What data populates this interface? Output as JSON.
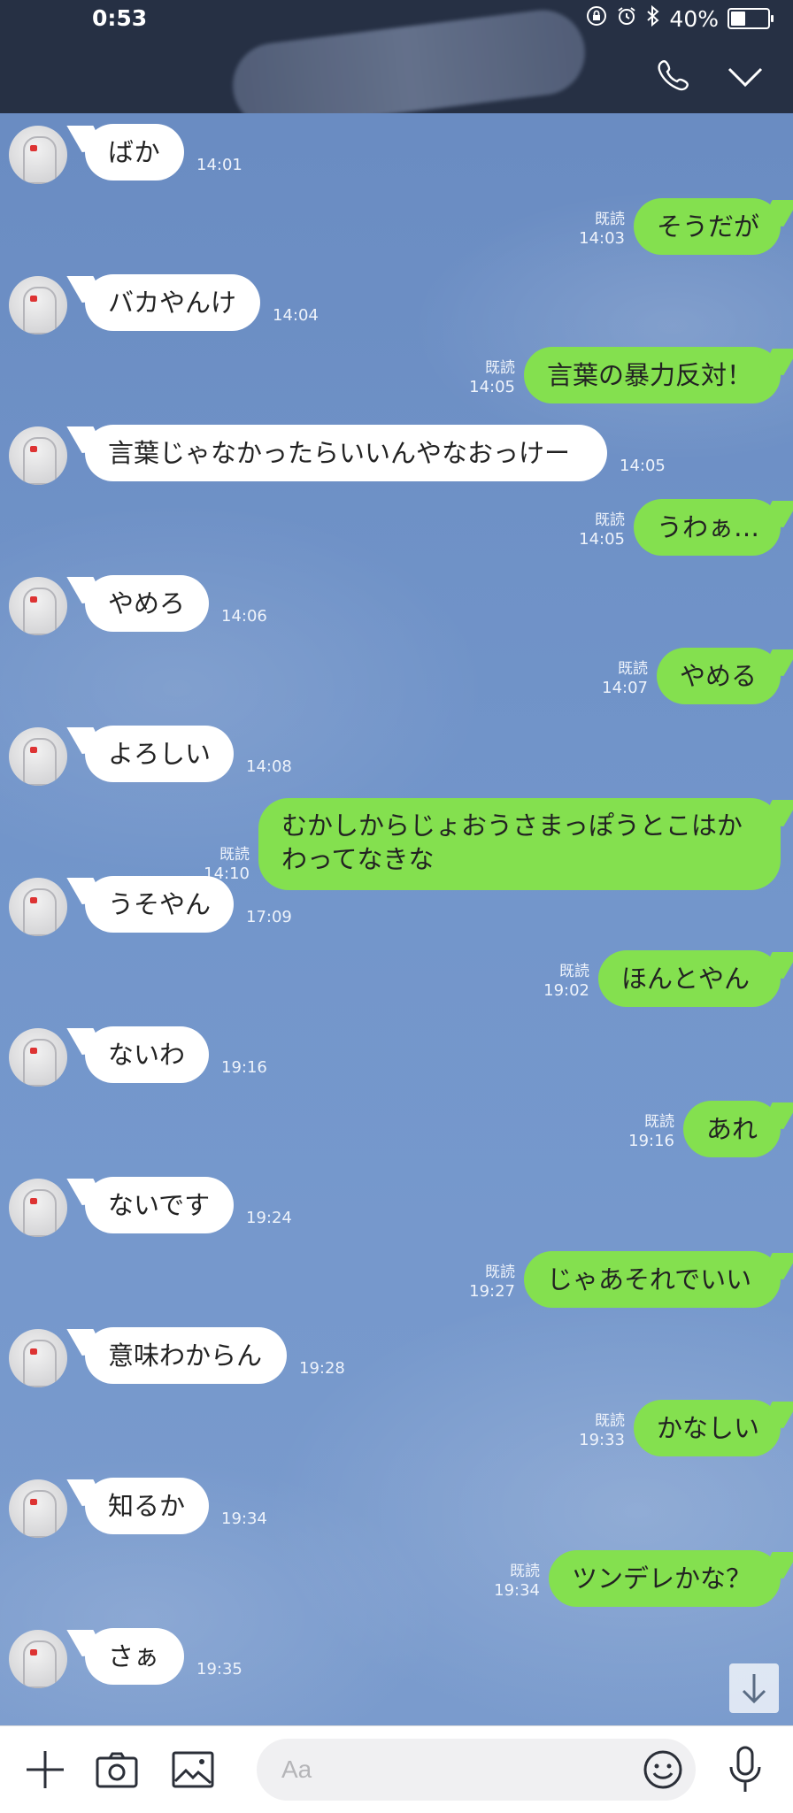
{
  "status_bar": {
    "time": "0:53",
    "battery": "40%",
    "battery_level": 0.4
  },
  "header": {
    "call_icon": "phone-icon",
    "collapse_icon": "chevron-down-icon"
  },
  "read_label": "既読",
  "messages": [
    {
      "side": "in",
      "text": "ばか",
      "time": "14:01"
    },
    {
      "side": "out",
      "text": "そうだが",
      "time": "14:03",
      "read": true
    },
    {
      "side": "in",
      "text": "バカやんけ",
      "time": "14:04"
    },
    {
      "side": "out",
      "text": "言葉の暴力反対！",
      "time": "14:05",
      "read": true
    },
    {
      "side": "in",
      "text": "言葉じゃなかったらいいんやなおっけー",
      "time": "14:05"
    },
    {
      "side": "out",
      "text": "うわぁ…",
      "time": "14:05",
      "read": true
    },
    {
      "side": "in",
      "text": "やめろ",
      "time": "14:06"
    },
    {
      "side": "out",
      "text": "やめる",
      "time": "14:07",
      "read": true
    },
    {
      "side": "in",
      "text": "よろしい",
      "time": "14:08"
    },
    {
      "side": "out",
      "text": "むかしからじょおうさまっぽうとこはかわってなきな",
      "time": "14:10",
      "read": true
    },
    {
      "side": "in",
      "text": "うそやん",
      "time": "17:09"
    },
    {
      "side": "out",
      "text": "ほんとやん",
      "time": "19:02",
      "read": true
    },
    {
      "side": "in",
      "text": "ないわ",
      "time": "19:16"
    },
    {
      "side": "out",
      "text": "あれ",
      "time": "19:16",
      "read": true
    },
    {
      "side": "in",
      "text": "ないです",
      "time": "19:24"
    },
    {
      "side": "out",
      "text": "じゃあそれでいい",
      "time": "19:27",
      "read": true
    },
    {
      "side": "in",
      "text": "意味わからん",
      "time": "19:28"
    },
    {
      "side": "out",
      "text": "かなしい",
      "time": "19:33",
      "read": true
    },
    {
      "side": "in",
      "text": "知るか",
      "time": "19:34"
    },
    {
      "side": "out",
      "text": "ツンデレかな？",
      "time": "19:34",
      "read": true
    },
    {
      "side": "in",
      "text": "さぁ",
      "time": "19:35"
    }
  ],
  "input": {
    "placeholder": "Aa"
  },
  "bottom_icons": [
    "plus-icon",
    "camera-icon",
    "image-icon",
    "emoji-icon",
    "mic-icon"
  ]
}
